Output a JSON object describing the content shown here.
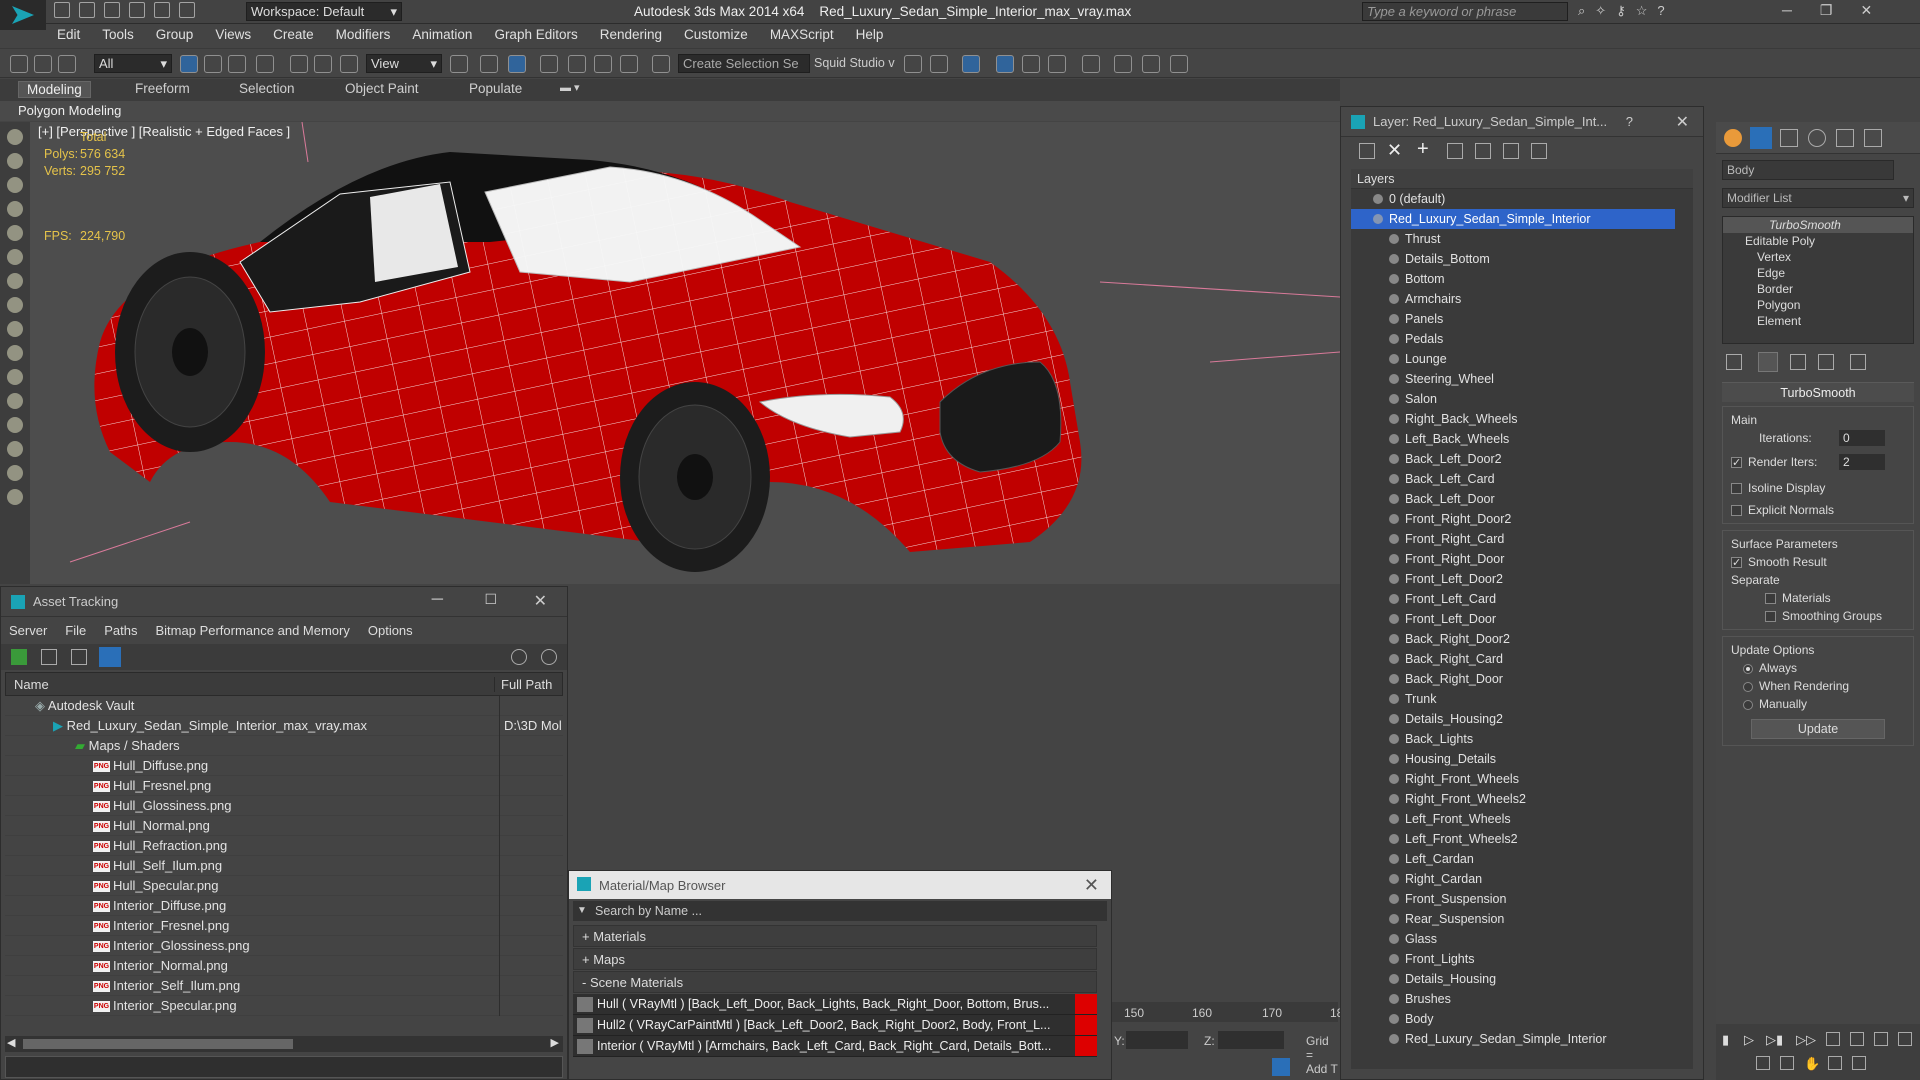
{
  "app": {
    "title": "Autodesk 3ds Max  2014 x64",
    "file": "Red_Luxury_Sedan_Simple_Interior_max_vray.max",
    "workspace": "Workspace: Default",
    "search_placeholder": "Type a keyword or phrase"
  },
  "menu": [
    "Edit",
    "Tools",
    "Group",
    "Views",
    "Create",
    "Modifiers",
    "Animation",
    "Graph Editors",
    "Rendering",
    "Customize",
    "MAXScript",
    "Help"
  ],
  "toolbar": {
    "selection_filter": "All",
    "ref_coord": "View",
    "named_selection": "Create Selection Se",
    "squid": "Squid Studio v"
  },
  "ribbon": {
    "tabs": [
      "Modeling",
      "Freeform",
      "Selection",
      "Object Paint",
      "Populate"
    ],
    "active": "Modeling",
    "sub_label": "Polygon Modeling"
  },
  "viewport": {
    "label": "[+] [Perspective ] [Realistic + Edged Faces ]",
    "stats": {
      "total_label": "Total",
      "polys_label": "Polys:",
      "polys_value": "576 634",
      "verts_label": "Verts:",
      "verts_value": "295 752",
      "fps_label": "FPS:",
      "fps_value": "224,790"
    },
    "colors": {
      "body": "#c00000",
      "wire": "#ffffff",
      "bg": "#4d4d4d"
    }
  },
  "asset_tracking": {
    "title": "Asset Tracking",
    "menu": [
      "Server",
      "File",
      "Paths",
      "Bitmap Performance and Memory",
      "Options"
    ],
    "col_name": "Name",
    "col_path": "Full Path",
    "vault": "Autodesk Vault",
    "file": "Red_Luxury_Sedan_Simple_Interior_max_vray.max",
    "file_path": "D:\\3D Mol",
    "maps_group": "Maps / Shaders",
    "png_badge": "PNG",
    "maps": [
      "Hull_Diffuse.png",
      "Hull_Fresnel.png",
      "Hull_Glossiness.png",
      "Hull_Normal.png",
      "Hull_Refraction.png",
      "Hull_Self_Ilum.png",
      "Hull_Specular.png",
      "Interior_Diffuse.png",
      "Interior_Fresnel.png",
      "Interior_Glossiness.png",
      "Interior_Normal.png",
      "Interior_Self_Ilum.png",
      "Interior_Specular.png"
    ]
  },
  "material_browser": {
    "title": "Material/Map Browser",
    "search_placeholder": "Search by Name ...",
    "sections": [
      "+ Materials",
      "+ Maps",
      "- Scene Materials"
    ],
    "materials": [
      "Hull  ( VRayMtl ) [Back_Left_Door, Back_Lights, Back_Right_Door, Bottom, Brus...",
      "Hull2  ( VRayCarPaintMtl ) [Back_Left_Door2, Back_Right_Door2, Body, Front_L...",
      "Interior  ( VRayMtl ) [Armchairs, Back_Left_Card, Back_Right_Card, Details_Bott..."
    ]
  },
  "timeline": {
    "ticks": [
      "150",
      "160",
      "170",
      "18"
    ],
    "y_label": "Y:",
    "z_label": "Z:",
    "grid_label": "Grid =",
    "add_label": "Add T"
  },
  "layer_explorer": {
    "title": "Layer: Red_Luxury_Sedan_Simple_Int...",
    "help": "?",
    "header": "Layers",
    "default_layer": "0 (default)",
    "selected_layer": "Red_Luxury_Sedan_Simple_Interior",
    "objects": [
      "Thrust",
      "Details_Bottom",
      "Bottom",
      "Armchairs",
      "Panels",
      "Pedals",
      "Lounge",
      "Steering_Wheel",
      "Salon",
      "Right_Back_Wheels",
      "Left_Back_Wheels",
      "Back_Left_Door2",
      "Back_Left_Card",
      "Back_Left_Door",
      "Front_Right_Door2",
      "Front_Right_Card",
      "Front_Right_Door",
      "Front_Left_Door2",
      "Front_Left_Card",
      "Front_Left_Door",
      "Back_Right_Door2",
      "Back_Right_Card",
      "Back_Right_Door",
      "Trunk",
      "Details_Housing2",
      "Back_Lights",
      "Housing_Details",
      "Right_Front_Wheels",
      "Right_Front_Wheels2",
      "Left_Front_Wheels",
      "Left_Front_Wheels2",
      "Left_Cardan",
      "Right_Cardan",
      "Front_Suspension",
      "Rear_Suspension",
      "Glass",
      "Front_Lights",
      "Details_Housing",
      "Brushes",
      "Body",
      "Red_Luxury_Sedan_Simple_Interior"
    ]
  },
  "command_panel": {
    "object_name": "Body",
    "modifier_list": "Modifier List",
    "stack": [
      "TurboSmooth",
      "Editable Poly",
      "Vertex",
      "Edge",
      "Border",
      "Polygon",
      "Element"
    ],
    "rollout_title": "TurboSmooth",
    "main_label": "Main",
    "iterations_label": "Iterations:",
    "iterations_value": "0",
    "render_iters_label": "Render Iters:",
    "render_iters_value": "2",
    "isoline": "Isoline Display",
    "explicit": "Explicit Normals",
    "surface_params": "Surface Parameters",
    "smooth_result": "Smooth Result",
    "separate": "Separate",
    "materials": "Materials",
    "smoothing_groups": "Smoothing Groups",
    "update_options": "Update Options",
    "always": "Always",
    "when_rendering": "When Rendering",
    "manually": "Manually",
    "update_button": "Update"
  }
}
